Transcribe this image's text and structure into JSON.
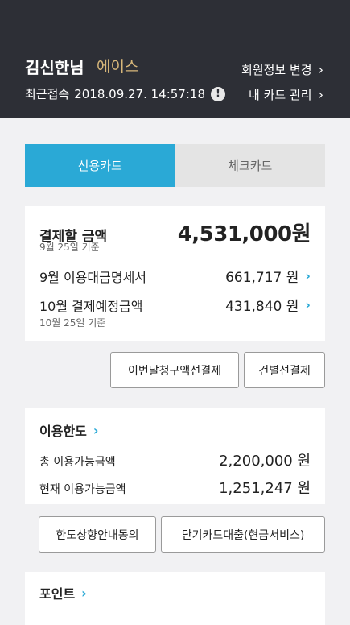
{
  "header": {
    "user_name": "김신한님",
    "grade": "에이스",
    "last_login_label": "최근접속",
    "last_login_time": "2018.09.27. 14:57:18",
    "info_icon": "!",
    "member_info_link": "회원정보 변경",
    "my_card_link": "내 카드 관리",
    "chevron": "›"
  },
  "tabs": [
    {
      "label": "신용카드",
      "active": true
    },
    {
      "label": "체크카드",
      "active": false
    }
  ],
  "billing": {
    "pay_label": "결제할 금액",
    "pay_amount": "4,531,000원",
    "pay_date_note": "9월 25일 기준",
    "statement_label": "9월 이용대금명세서",
    "statement_amount": "661,717 원",
    "scheduled_label": "10월 결제예정금액",
    "scheduled_amount": "431,840 원",
    "scheduled_date_note": "10월 25일 기준",
    "chevron": "›"
  },
  "actions": {
    "prepay_this_month": "이번달청구액선결제",
    "prepay_by_item": "건별선결제"
  },
  "limit": {
    "title": "이용한도",
    "total_label": "총 이용가능금액",
    "total_amount": "2,200,000 원",
    "current_label": "현재 이용가능금액",
    "current_amount": "1,251,247 원",
    "chevron": "›"
  },
  "limit_actions": {
    "limit_increase_consent": "한도상향안내동의",
    "short_term_loan": "단기카드대출(현금서비스)"
  },
  "points": {
    "title": "포인트",
    "chevron": "›"
  }
}
